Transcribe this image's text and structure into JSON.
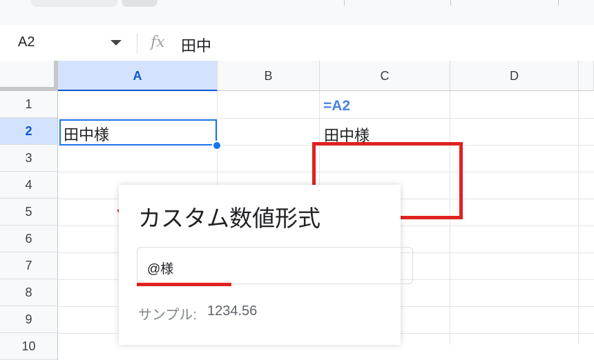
{
  "formula_bar": {
    "name_box": "A2",
    "fx_label": "fx",
    "content": "田中"
  },
  "columns": [
    "A",
    "B",
    "C",
    "D"
  ],
  "rows": [
    "1",
    "2",
    "3",
    "4",
    "5",
    "6",
    "7",
    "8",
    "9",
    "10"
  ],
  "cells": {
    "A2": "田中様",
    "C1": "=A2",
    "C2": "田中様"
  },
  "format_panel": {
    "title": "カスタム数値形式",
    "input_value": "@様",
    "sample_label": "サンプル:",
    "sample_value": "1234.56"
  },
  "colors": {
    "selection": "#1a73e8",
    "annotation_red": "#e02121",
    "formula_text": "#4c82e3"
  }
}
